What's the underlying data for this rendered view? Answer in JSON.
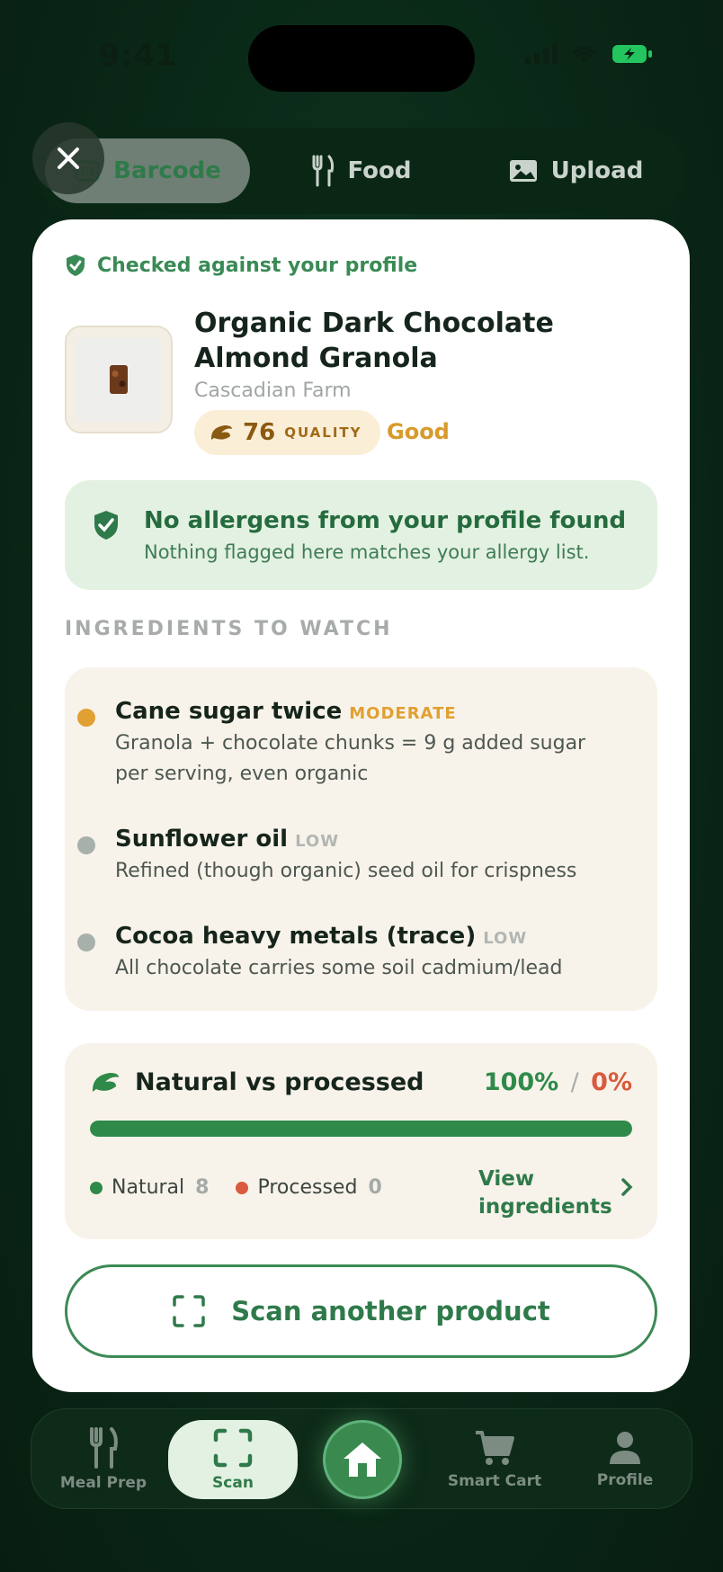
{
  "status": {
    "time": "9:41"
  },
  "tabs": [
    {
      "label": "Barcode",
      "icon": "barcode-icon",
      "active": true
    },
    {
      "label": "Food",
      "icon": "fork-knife-icon",
      "active": false
    },
    {
      "label": "Upload",
      "icon": "image-icon",
      "active": false
    }
  ],
  "result": {
    "checked_label": "Checked against your profile",
    "product_title": "Organic Dark Chocolate Almond Granola",
    "brand": "Cascadian Farm",
    "score": "76",
    "score_label": "QUALITY",
    "score_word": "Good",
    "allergen_title": "No allergens from your profile found",
    "allergen_sub": "Nothing flagged here matches your allergy list.",
    "watch_heading": "INGREDIENTS TO WATCH",
    "watch_items": [
      {
        "name": "Cane sugar twice",
        "level": "MODERATE",
        "color": "#e0a032",
        "desc": "Granola + chocolate chunks = 9 g added sugar per serving, even organic"
      },
      {
        "name": "Sunflower oil",
        "level": "LOW",
        "color": "#a8b0ab",
        "desc": "Refined (though organic) seed oil for crispness"
      },
      {
        "name": "Cocoa heavy metals (trace)",
        "level": "LOW",
        "color": "#a8b0ab",
        "desc": "All chocolate carries some soil cadmium/lead"
      }
    ],
    "nvp": {
      "title": "Natural vs processed",
      "natural_pct": "100%",
      "separator": "/",
      "processed_pct": "0%",
      "natural_fraction": 1.0,
      "natural_label": "Natural",
      "natural_count": "8",
      "processed_label": "Processed",
      "processed_count": "0",
      "view_link": "View ingredients"
    },
    "scan_again_label": "Scan another product"
  },
  "nav": [
    {
      "label": "Meal Prep",
      "icon": "fork-knife-icon"
    },
    {
      "label": "Scan",
      "icon": "scan-icon",
      "active": true
    },
    {
      "label": "Home",
      "icon": "home-icon"
    },
    {
      "label": "Smart Cart",
      "icon": "cart-icon"
    },
    {
      "label": "Profile",
      "icon": "person-icon"
    }
  ],
  "colors": {
    "accent": "#2f7a4a",
    "moderate": "#e0a032",
    "processed": "#d95a3e"
  }
}
